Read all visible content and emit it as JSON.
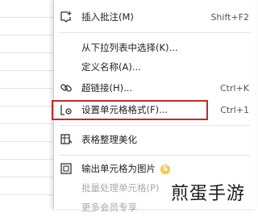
{
  "menu": {
    "items": [
      {
        "label": "插入批注(M)",
        "shortcut": "Shift+F2",
        "icon": "insert-comment-icon"
      },
      {
        "label": "从下拉列表中选择(K)...",
        "shortcut": "",
        "icon": ""
      },
      {
        "label": "定义名称(A)...",
        "shortcut": "",
        "icon": ""
      },
      {
        "label": "超链接(H)...",
        "shortcut": "Ctrl+K",
        "icon": "hyperlink-icon"
      },
      {
        "label": "设置单元格格式(F)...",
        "shortcut": "Ctrl+1",
        "icon": "format-cells-icon"
      },
      {
        "label": "表格整理美化",
        "shortcut": "",
        "icon": "table-beautify-icon"
      },
      {
        "label": "输出单元格为图片",
        "shortcut": "",
        "icon": "export-image-icon",
        "badge": "S"
      },
      {
        "label": "批量处理单元格(P)",
        "shortcut": "",
        "icon": ""
      },
      {
        "label": "更多会员专享",
        "shortcut": "",
        "icon": ""
      }
    ]
  },
  "watermark": "煎蛋手游",
  "colors": {
    "highlight": "#c62828",
    "badge": "#f6c744"
  }
}
